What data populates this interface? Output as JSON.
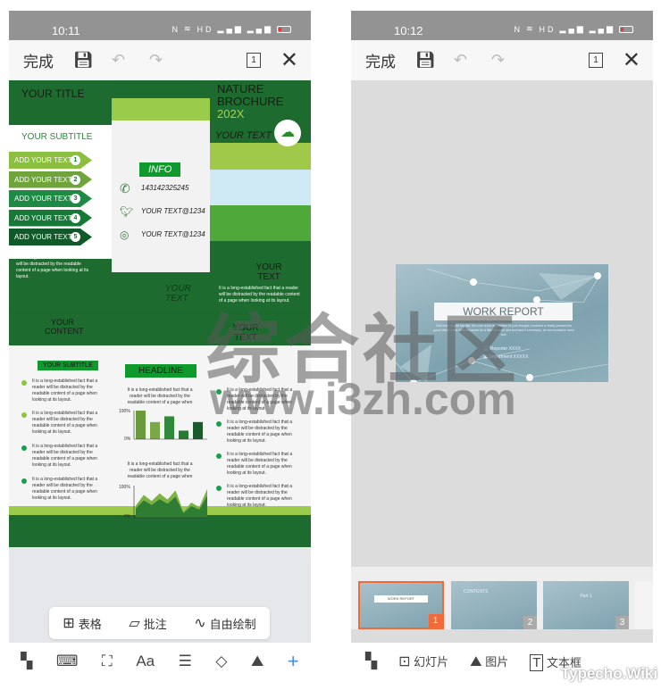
{
  "left": {
    "status": {
      "time": "10:11",
      "icons": [
        "nfc-icon",
        "wifi-icon",
        "hd-icon",
        "signal-icon",
        "signal-icon",
        "battery-icon"
      ]
    },
    "toolbar": {
      "done": "完成",
      "page": "1"
    },
    "brochure": {
      "title": "YOUR TITLE",
      "subtitle": "YOUR SUBTITLE",
      "items": [
        {
          "label": "ADD YOUR TEXT",
          "n": "1"
        },
        {
          "label": "ADD YOUR TEXT",
          "n": "2"
        },
        {
          "label": "ADD YOUR TEXT",
          "n": "3"
        },
        {
          "label": "ADD YOUR TEXT",
          "n": "4"
        },
        {
          "label": "ADD YOUR TEXT",
          "n": "5"
        }
      ],
      "body": "It is a long-established fact that a reader will be distracted by the readable content of a page when looking at its layout.",
      "body_short": "It is a long-established fact that a reader will be distracted by the readable content of a page when",
      "info": "INFO",
      "phone": "143142325245",
      "twitter": "YOUR TEXT@1234",
      "instagram": "YOUR TEXT@1234",
      "your_text": "YOUR TEXT",
      "nature": "NATURE",
      "brochure": "BROCHURE",
      "year": "202X",
      "your_content": "YOUR CONTENT",
      "headline": "HEADLINE",
      "bar_values": [
        100,
        60,
        80,
        30,
        60
      ],
      "bar_labels": [
        "100%",
        "0%"
      ],
      "area_values": [
        40,
        75,
        55,
        80,
        60,
        90,
        20,
        50,
        35,
        95
      ]
    },
    "menu": [
      {
        "icon": "table-icon",
        "label": "表格"
      },
      {
        "icon": "comment-icon",
        "label": "批注"
      },
      {
        "icon": "freehand-icon",
        "label": "自由绘制"
      }
    ],
    "bottom": [
      "apps-icon",
      "keyboard-icon",
      "frame-icon",
      "font-icon",
      "align-icon",
      "paint-icon",
      "image-icon",
      "add-icon"
    ],
    "accent": "#4a8fe0"
  },
  "right": {
    "status": {
      "time": "10:12"
    },
    "toolbar": {
      "done": "完成",
      "page": "1"
    },
    "slide": {
      "title": "WORK REPORT",
      "body": "Click here to add the title, the core is the expression of your thought, modeled to finally present the good effect of the relevant words for a little Genuine and text sent if necessary, do not excessive more text.",
      "reporter": "Reporter XXXX",
      "department": "Department XXXXX"
    },
    "thumbs": [
      {
        "n": "1",
        "text": "WORK REPORT",
        "selected": true
      },
      {
        "n": "2",
        "text": "CONTENTS"
      },
      {
        "n": "3",
        "text": "Part 1"
      }
    ],
    "bottom": [
      {
        "icon": "apps-icon",
        "label": ""
      },
      {
        "icon": "add-slide-icon",
        "label": "幻灯片"
      },
      {
        "icon": "image-icon",
        "label": "图片"
      },
      {
        "icon": "textbox-icon",
        "label": "文本框"
      }
    ],
    "accent": "#f06a3a"
  },
  "watermark": {
    "text": "综合社区",
    "url": "www.i3zh.com",
    "corner": "Typecho.Wiki"
  }
}
